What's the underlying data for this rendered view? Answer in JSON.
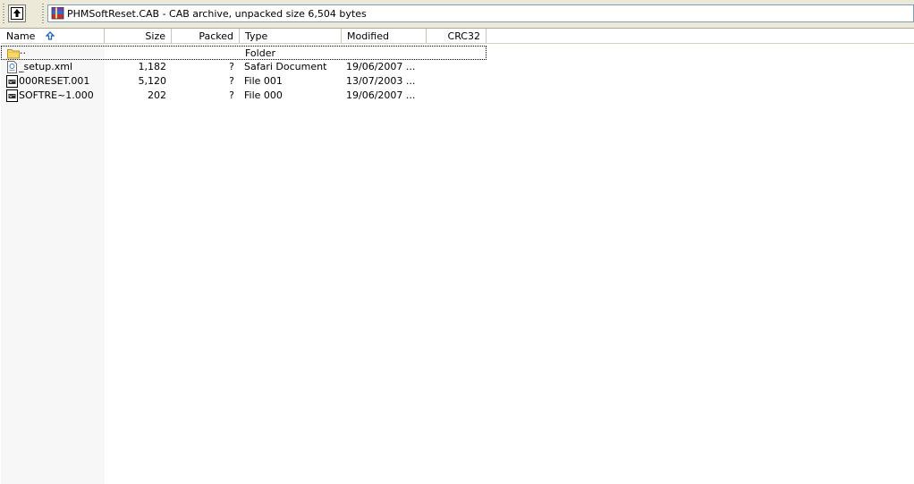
{
  "address_bar": {
    "archive_info": "PHMSoftReset.CAB - CAB archive, unpacked size 6,504 bytes"
  },
  "columns": {
    "name": "Name",
    "size": "Size",
    "packed": "Packed",
    "type": "Type",
    "modified": "Modified",
    "crc32": "CRC32"
  },
  "rows": [
    {
      "name": "..",
      "size": "",
      "packed": "",
      "type": "Folder",
      "modified": "",
      "crc": "",
      "icon": "folder-icon",
      "selected": true
    },
    {
      "name": "_setup.xml",
      "size": "1,182",
      "packed": "?",
      "type": "Safari Document",
      "modified": "19/06/2007 ...",
      "crc": "",
      "icon": "xml-file-icon",
      "selected": false
    },
    {
      "name": "000RESET.001",
      "size": "5,120",
      "packed": "?",
      "type": "File 001",
      "modified": "13/07/2003 ...",
      "crc": "",
      "icon": "file-icon",
      "selected": false
    },
    {
      "name": "SOFTRE~1.000",
      "size": "202",
      "packed": "?",
      "type": "File 000",
      "modified": "19/06/2007 ...",
      "crc": "",
      "icon": "file-icon",
      "selected": false
    }
  ],
  "colors": {
    "toolbar_bg": "#ece9d8",
    "name_column_shade": "#f7f7f7",
    "up_arrow_sort": "#1c5fbf",
    "folder": "#f7d86a"
  }
}
